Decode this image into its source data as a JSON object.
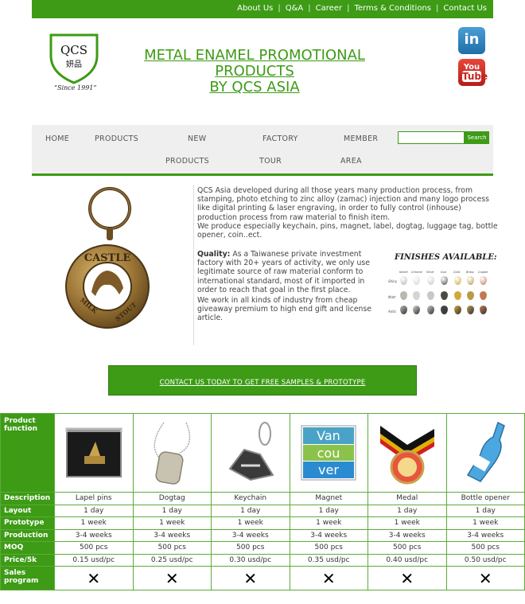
{
  "top_links": [
    "About Us",
    "Q&A",
    "Career",
    "Terms & Conditions",
    "Contact Us"
  ],
  "logo": {
    "name": "QCS",
    "chinese": "妍品",
    "since": "“Since 1991”"
  },
  "headline": {
    "line1": "METAL ENAMEL PROMOTIONAL",
    "line2": "PRODUCTS",
    "line3": "BY QCS ASIA"
  },
  "social": {
    "linkedin": "in",
    "youtube_top": "You",
    "youtube_bottom": "Tube"
  },
  "nav": {
    "home": "HOME",
    "products": "PRODUCTS",
    "new_1": "NEW",
    "new_2": "PRODUCTS",
    "factory_1": "FACTORY",
    "factory_2": "TOUR",
    "member_1": "MEMBER",
    "member_2": "AREA",
    "search_button": "Search"
  },
  "content": {
    "intro_1": "QCS Asia developed during all those years many production process, from stamping, photo etching to zinc alloy (zamac) injection and many logo process like digital printing & laser engraving, in order to fully control (inhouse) production process from raw material to finish item.",
    "intro_2": "We produce especially keychain, pins, magnet, label, dogtag, luggage tag, bottle opener, coin..ect.",
    "quality_label": "Quality:",
    "quality_text": " As a Taiwanese private investment factory with 20+ years of activity, we only use legitimate source of raw material conform to international standard, most of it imported in order to reach that goal in the first place.",
    "work_text": "We work in all kinds of industry from cheap giveaway premium to high end gift and license article.",
    "finishes_title": "FINISHES AVAILABLE:",
    "finish_columns": [
      "Nickel",
      "Chrome",
      "Silver",
      "Gun",
      "Gold",
      "Brass",
      "Copper"
    ],
    "finish_rows": [
      "Shiny",
      "Matt",
      "Antic"
    ],
    "keychain_text_top": "CASTLE",
    "keychain_text_left": "MILK",
    "keychain_text_right": "STOUT"
  },
  "cta": "CONTACT US TODAY TO GET FREE SAMPLES & PROTOTYPE",
  "table": {
    "headers": {
      "product_function": "Product function",
      "description": "Description",
      "layout": "Layout",
      "prototype": "Prototype",
      "production": "Production",
      "moq": "MOQ",
      "price": "Price/5k",
      "sales": "Sales program"
    },
    "products": [
      {
        "description": "Lapel pins",
        "layout": "1 day",
        "prototype": "1 week",
        "production": "3-4 weeks",
        "moq": "500 pcs",
        "price": "0.15 usd/pc",
        "sales": "✕"
      },
      {
        "description": "Dogtag",
        "layout": "1 day",
        "prototype": "1 week",
        "production": "3-4 weeks",
        "moq": "500 pcs",
        "price": "0.25 usd/pc",
        "sales": "✕"
      },
      {
        "description": "Keychain",
        "layout": "1 day",
        "prototype": "1 week",
        "production": "3-4 weeks",
        "moq": "500 pcs",
        "price": "0.30 usd/pc",
        "sales": "✕"
      },
      {
        "description": "Magnet",
        "layout": "1 day",
        "prototype": "1 week",
        "production": "3-4 weeks",
        "moq": "500 pcs",
        "price": "0.35 usd/pc",
        "sales": "✕"
      },
      {
        "description": "Medal",
        "layout": "1 day",
        "prototype": "1 week",
        "production": "3-4 weeks",
        "moq": "500 pcs",
        "price": "0.40 usd/pc",
        "sales": "✕"
      },
      {
        "description": "Bottle opener",
        "layout": "1 day",
        "prototype": "1 week",
        "production": "3-4 weeks",
        "moq": "500 pcs",
        "price": "0.50 usd/pc",
        "sales": "✕"
      }
    ],
    "magnet_text": [
      "Van",
      "cou",
      "ver"
    ]
  },
  "colors": {
    "brand_green": "#3d9b15",
    "nav_bg": "#efefef"
  }
}
